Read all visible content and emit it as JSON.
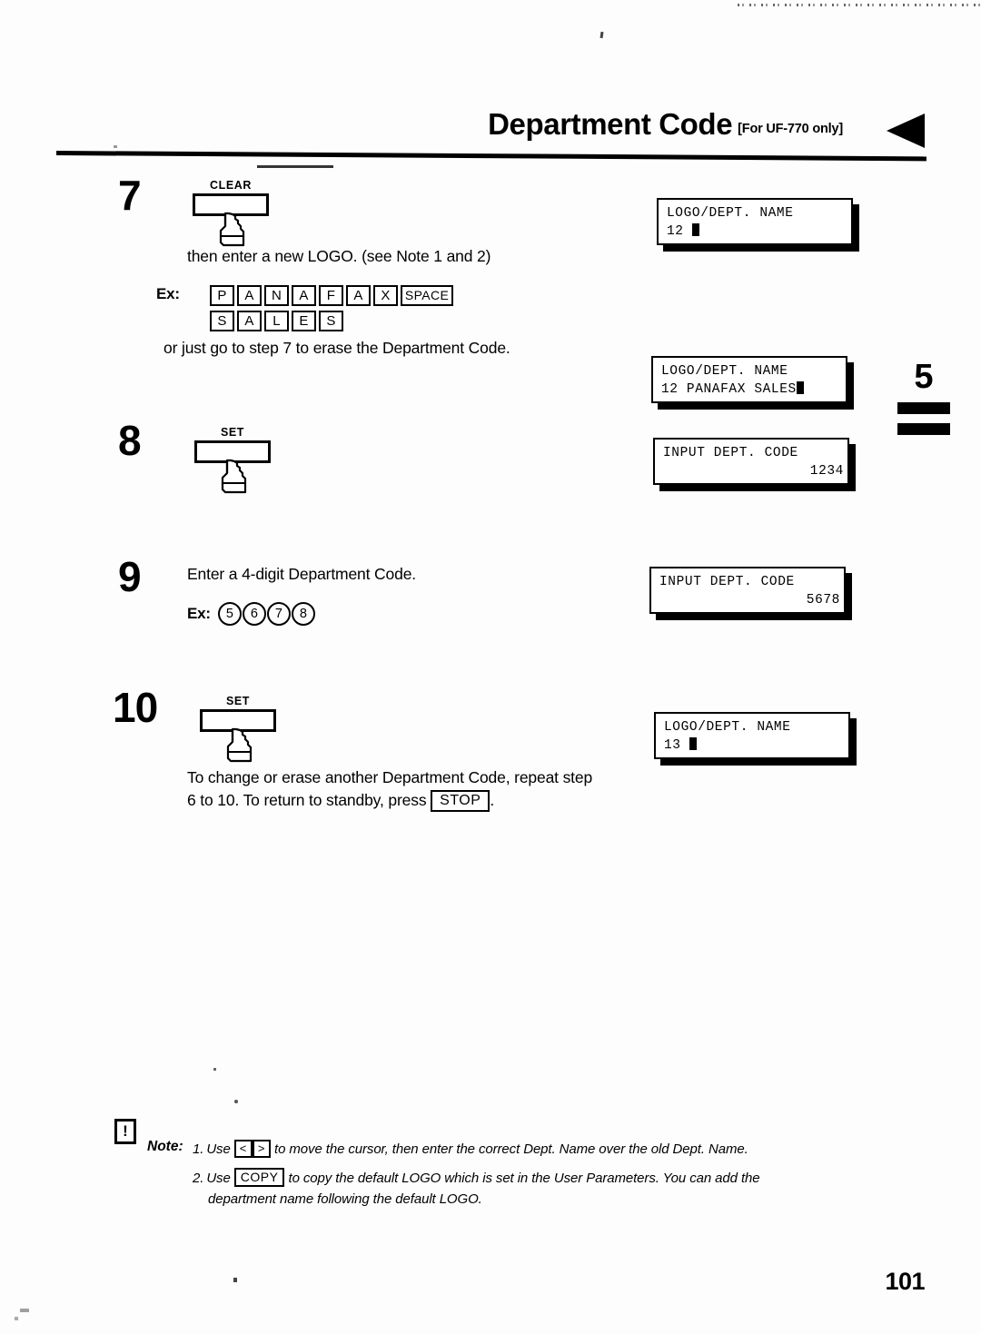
{
  "header": {
    "title": "Department Code",
    "subtitle": "[For UF-770 only]",
    "arrow_icon": "left-triangle-icon"
  },
  "chapter_tab": {
    "number": "5"
  },
  "steps": [
    {
      "number": "7",
      "key_label": "CLEAR",
      "text_lines": [
        "then enter a new LOGO.  (see Note 1 and 2)"
      ],
      "example_label": "Ex:",
      "example_keys_row1": [
        "P",
        "A",
        "N",
        "A",
        "F",
        "A",
        "X",
        "SPACE"
      ],
      "example_keys_row2": [
        "S",
        "A",
        "L",
        "E",
        "S"
      ],
      "after_text": "or just go to step 7 to erase the Department Code."
    },
    {
      "number": "8",
      "key_label": "SET"
    },
    {
      "number": "9",
      "text_lines": [
        "Enter a 4-digit Department Code."
      ],
      "example_label": "Ex:",
      "example_digits": [
        "5",
        "6",
        "7",
        "8"
      ]
    },
    {
      "number": "10",
      "key_label": "SET",
      "after_text_line1": "To change or erase another Department Code, repeat step",
      "after_text_line2_pre": "6 to 10.  To return to standby, press",
      "after_text_key": "STOP",
      "after_text_line2_post": "."
    }
  ],
  "lcd_panels": [
    {
      "line1": "LOGO/DEPT. NAME",
      "line2": "12",
      "cursor": true,
      "align": "left"
    },
    {
      "line1": "LOGO/DEPT. NAME",
      "line2": "12 PANAFAX SALES",
      "cursor": true,
      "align": "left"
    },
    {
      "line1": "INPUT DEPT. CODE",
      "line2": "1234",
      "cursor": false,
      "align": "right"
    },
    {
      "line1": "INPUT DEPT. CODE",
      "line2": "5678",
      "cursor": false,
      "align": "right"
    },
    {
      "line1": "LOGO/DEPT. NAME",
      "line2": "13",
      "cursor": true,
      "align": "left"
    }
  ],
  "notes": {
    "icon": "exclamation-box-icon",
    "icon_glyph": "!",
    "label": "Note:",
    "items": [
      {
        "number": "1.",
        "pre": "Use",
        "key_left": "<",
        "key_right": ">",
        "post": "to move the cursor, then enter the correct Dept.  Name over the old Dept. Name."
      },
      {
        "number": "2.",
        "pre": "Use",
        "key": "COPY",
        "post": "to copy the default LOGO which is set in the User Parameters.  You can add the",
        "continuation": "department name following the default LOGO."
      }
    ]
  },
  "page_number": "101"
}
